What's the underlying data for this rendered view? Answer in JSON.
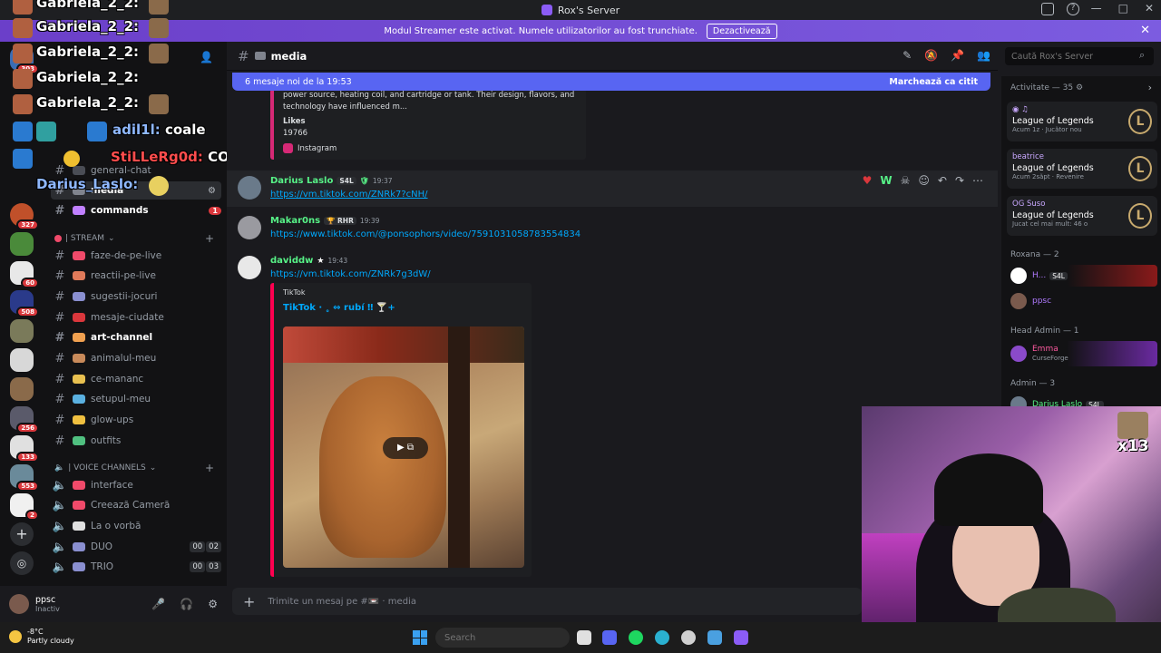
{
  "window": {
    "title": "Rox's Server"
  },
  "streamer_bar": {
    "text": "Modul Streamer este activat. Numele utilizatorilor au fost trunchiate.",
    "button": "Dezactivează"
  },
  "overlay_chat": [
    {
      "name": "Gabriela_2_2:"
    },
    {
      "name": "Gabriela_2_2:"
    },
    {
      "name": "Gabriela_2_2:"
    },
    {
      "name": "Gabriela_2_2:"
    },
    {
      "name": "adil1l:",
      "text": "coale"
    },
    {
      "name": "StiLLeRg0d:",
      "text": "COAIE"
    },
    {
      "name": "Darius_Laslo:"
    }
  ],
  "rail_badges": [
    "303",
    "327",
    "60",
    "508",
    "256",
    "133",
    "553",
    "2"
  ],
  "sidebar": {
    "channels_top": [
      {
        "name": "general-chat"
      },
      {
        "name": "media"
      },
      {
        "name": "commands",
        "count": "1"
      }
    ],
    "stream_category": "| STREAM",
    "stream_channels": [
      "faze-de-pe-live",
      "reactii-pe-live",
      "sugestii-jocuri",
      "mesaje-ciudate",
      "art-channel",
      "animalul-meu",
      "ce-mananc",
      "setupul-meu",
      "glow-ups",
      "outfits"
    ],
    "voice_category": "| VOICE CHANNELS",
    "voice_channels": [
      {
        "name": "interface"
      },
      {
        "name": "Creează Cameră"
      },
      {
        "name": "La o vorbă"
      },
      {
        "name": "DUO",
        "a": "00",
        "b": "02"
      },
      {
        "name": "TRIO",
        "a": "00",
        "b": "03"
      }
    ]
  },
  "user_panel": {
    "name": "ppsc",
    "status": "Inactiv"
  },
  "channel_header": {
    "title": "media"
  },
  "search": {
    "placeholder": "Caută Rox's Server"
  },
  "new_messages": {
    "text": "6 mesaje noi de la 19:53",
    "mark": "Marchează ca citit"
  },
  "embed_ig": {
    "snippet_1": "power source, heating coil, and cartridge or tank. Their design, flavors, and",
    "snippet_2": "technology have influenced m...",
    "likes_label": "Likes",
    "likes_value": "19766",
    "provider": "Instagram"
  },
  "messages": [
    {
      "name": "Darius Laslo",
      "tag": "S4L",
      "time": "19:37",
      "link": "https://vm.tiktok.com/ZNRk7?cNH/"
    },
    {
      "name": "Makar0ns",
      "tag": "RHR",
      "time": "19:39",
      "link": "https://www.tiktok.com/@ponsophors/video/7591031058783554834"
    },
    {
      "name": "daviddw",
      "time": "19:43",
      "link": "https://vm.tiktok.com/ZNRk7g3dW/"
    }
  ],
  "tiktok_embed": {
    "provider": "TikTok",
    "title": "TikTok · ˳ ⇔ rubí ‼ 🍸+"
  },
  "composer": {
    "placeholder": "Trimite un mesaj pe #📼 · media"
  },
  "members": {
    "activity_title": "Activitate — 35",
    "activity": [
      {
        "user": "",
        "game": "League of Legends",
        "status": "Acum 1z · Jucător nou"
      },
      {
        "user": "beatrice",
        "game": "League of Legends",
        "status": "Acum 2săpt · Revenire"
      },
      {
        "user": "OG Suso",
        "game": "League of Legends",
        "status": "Jucat cel mai mult: 46 o"
      }
    ],
    "group_roxana": "Roxana — 2",
    "roxana_members": [
      {
        "name": "H...",
        "tag": "S4L"
      },
      {
        "name": "ppsc"
      }
    ],
    "group_head_admin": "Head Admin — 1",
    "head_admin": {
      "name": "Emma",
      "status": "CurseForge"
    },
    "group_admin": "Admin — 3",
    "admin_first": {
      "name": "Darius Laslo",
      "tag": "S4L"
    }
  },
  "overlay_counter": "x13",
  "taskbar": {
    "temp": "-8°C",
    "weather": "Partly cloudy",
    "search": "Search"
  }
}
